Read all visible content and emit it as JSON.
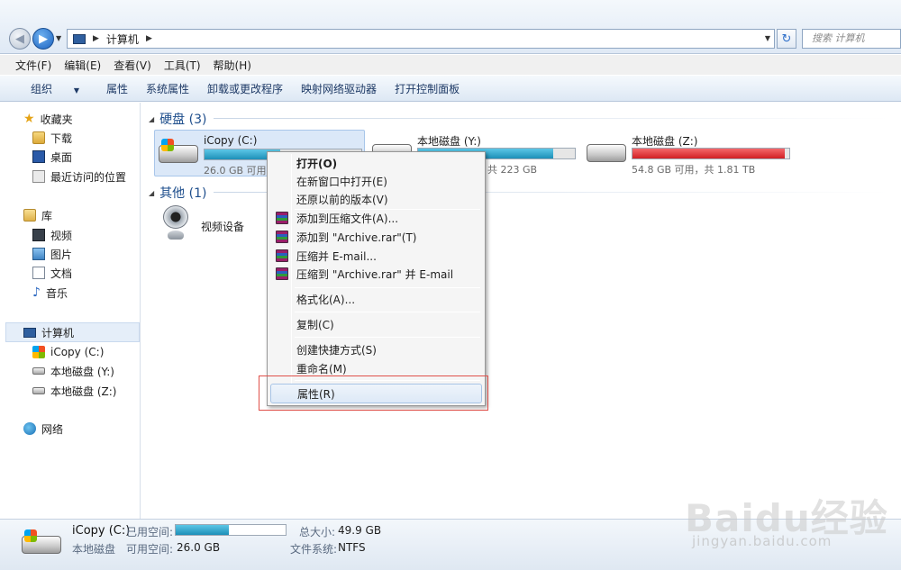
{
  "address": {
    "path_label": "计算机",
    "search_placeholder": "搜索 计算机"
  },
  "menubar": [
    "文件(F)",
    "编辑(E)",
    "查看(V)",
    "工具(T)",
    "帮助(H)"
  ],
  "toolbar": [
    "组织",
    "属性",
    "系统属性",
    "卸载或更改程序",
    "映射网络驱动器",
    "打开控制面板"
  ],
  "sidebar": {
    "favorites": "收藏夹",
    "favorites_items": [
      "下载",
      "桌面",
      "最近访问的位置"
    ],
    "library": "库",
    "library_items": [
      "视频",
      "图片",
      "文档",
      "音乐"
    ],
    "computer": "计算机",
    "computer_items": [
      "iCopy (C:)",
      "本地磁盘 (Y:)",
      "本地磁盘 (Z:)"
    ],
    "network": "网络"
  },
  "content": {
    "group_hdd": "硬盘 (3)",
    "group_other": "其他 (1)",
    "drives": [
      {
        "name": "iCopy (C:)",
        "info": "26.0 GB 可用",
        "used_fraction": 0.48
      },
      {
        "name": "本地磁盘 (Y:)",
        "info": "共 223 GB",
        "used_fraction": 0.86
      },
      {
        "name": "本地磁盘 (Z:)",
        "info": "54.8 GB 可用，共 1.81 TB",
        "used_fraction": 0.97
      }
    ],
    "other_items": [
      "视频设备"
    ]
  },
  "context_menu": {
    "items": [
      "打开(O)",
      "在新窗口中打开(E)",
      "还原以前的版本(V)",
      "添加到压缩文件(A)...",
      "添加到 \"Archive.rar\"(T)",
      "压缩并 E-mail...",
      "压缩到 \"Archive.rar\" 并 E-mail",
      "格式化(A)...",
      "复制(C)",
      "创建快捷方式(S)",
      "重命名(M)",
      "属性(R)"
    ]
  },
  "details": {
    "name": "iCopy (C:)",
    "type": "本地磁盘",
    "used_label": "已用空间:",
    "free_label": "可用空间:",
    "free_value": "26.0 GB",
    "total_label": "总大小:",
    "total_value": "49.9 GB",
    "fs_label": "文件系统:",
    "fs_value": "NTFS",
    "used_fraction": 0.48
  },
  "watermark": {
    "text": "Baidu经验",
    "url": "jingyan.baidu.com"
  },
  "colors": {
    "accent": "#1e4e8c",
    "bar_blue": "#1d8fb8",
    "bar_red": "#d11f24",
    "highlight_box": "#e0504a"
  }
}
